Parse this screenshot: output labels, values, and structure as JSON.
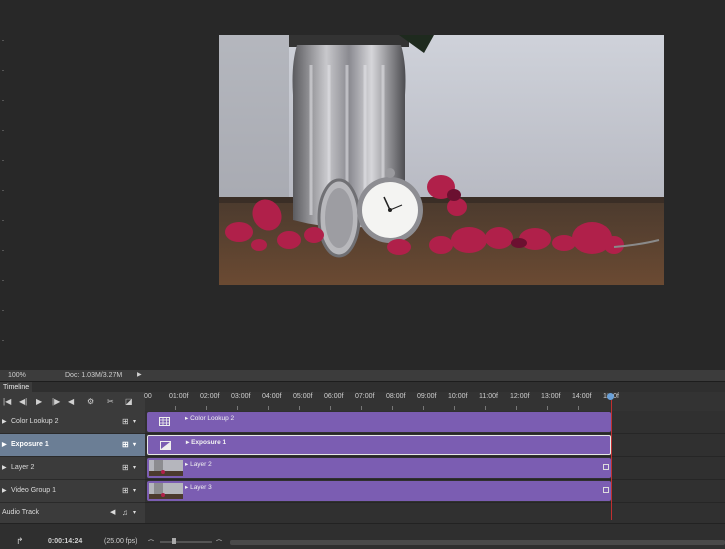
{
  "status_bar": {
    "zoom": "100%",
    "doc_size": "Doc: 1.03M/3.27M"
  },
  "panel": {
    "title": "Timeline"
  },
  "ruler": {
    "labels": [
      "00",
      "01:00f",
      "02:00f",
      "03:00f",
      "04:00f",
      "05:00f",
      "06:00f",
      "07:00f",
      "08:00f",
      "09:00f",
      "10:00f",
      "11:00f",
      "12:00f",
      "13:00f",
      "14:00f",
      "1□:0f"
    ]
  },
  "tracks": [
    {
      "name": "Color Lookup 2",
      "clip_label": "Color Lookup 2",
      "selected": false,
      "kind": "adjustment"
    },
    {
      "name": "Exposure 1",
      "clip_label": "Exposure 1",
      "selected": true,
      "kind": "adjustment"
    },
    {
      "name": "Layer 2",
      "clip_label": "Layer 2",
      "selected": false,
      "kind": "video"
    },
    {
      "name": "Video Group 1",
      "clip_label": "Layer 3",
      "selected": false,
      "kind": "video"
    }
  ],
  "audio": {
    "name": "Audio Track"
  },
  "bottom": {
    "timecode": "0:00:14:24",
    "fps": "(25.00 fps)"
  },
  "colors": {
    "clip": "#7b5db2",
    "selection": "#6b7e95",
    "playhead": "#c03030",
    "background": "#282828"
  },
  "icons": {
    "transport": [
      "first-frame-icon",
      "prev-frame-icon",
      "play-icon",
      "next-frame-icon",
      "last-frame-icon",
      "audio-icon",
      "settings-icon",
      "split-icon",
      "transition-icon"
    ]
  }
}
